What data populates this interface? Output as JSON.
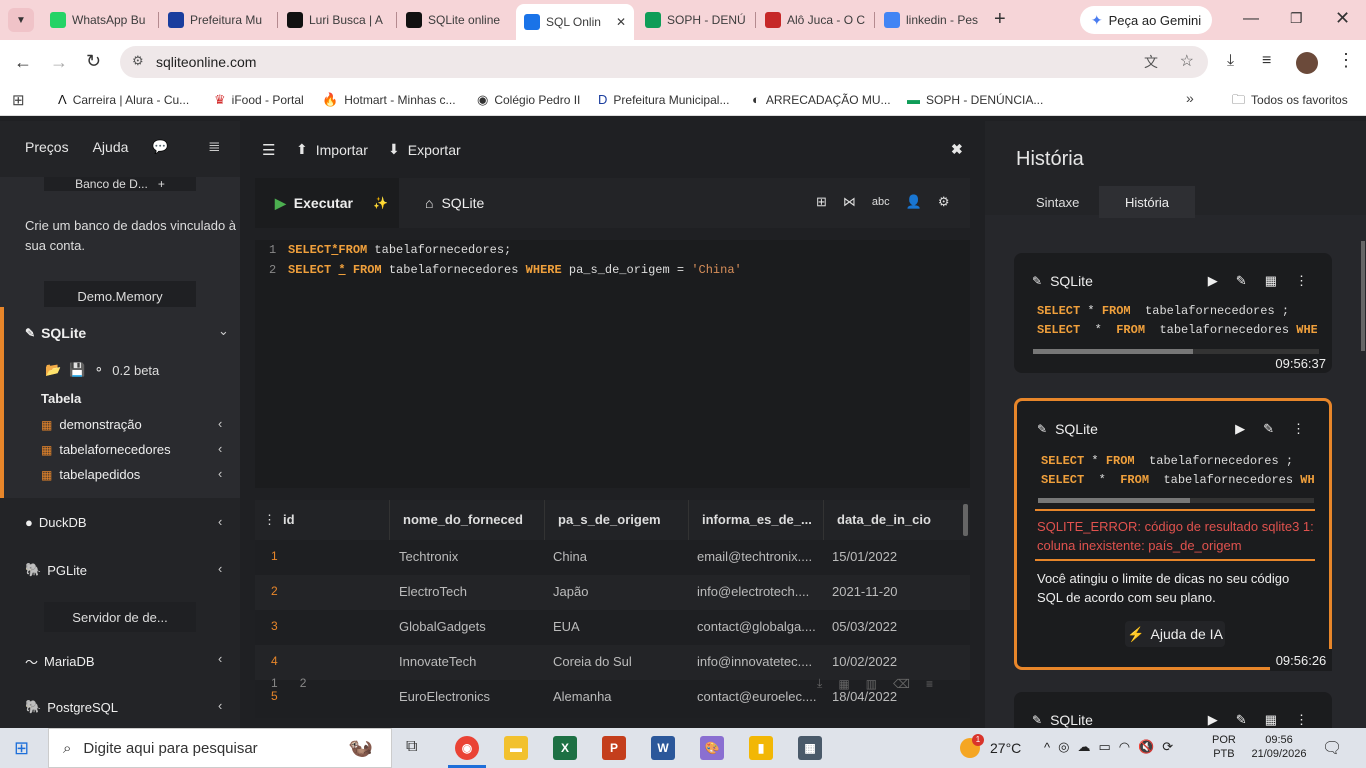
{
  "browser": {
    "tabs": [
      {
        "title": "WhatsApp Bu",
        "icon": "whatsapp-icon",
        "color": "#25d366"
      },
      {
        "title": "Prefeitura Mu",
        "icon": "prefeitura-icon",
        "color": "#1a3d9e"
      },
      {
        "title": "Luri Busca | A",
        "icon": "luri-icon",
        "color": "#111111"
      },
      {
        "title": "SQLite online",
        "icon": "sqlite-icon",
        "color": "#111111"
      },
      {
        "title": "SQL Onlin",
        "icon": "sqlonline-icon",
        "color": "#1a73e8"
      },
      {
        "title": "SOPH - DENÚ",
        "icon": "soph-icon",
        "color": "#0f9d58"
      },
      {
        "title": "Alô Juca - O C",
        "icon": "alojuca-icon",
        "color": "#c62828"
      },
      {
        "title": "linkedin - Pes",
        "icon": "google-icon",
        "color": "#4285f4"
      }
    ],
    "gemini_label": "Peça ao Gemini",
    "url": "sqliteonline.com",
    "bookmarks": [
      "Carreira | Alura - Cu...",
      "iFood - Portal",
      "Hotmart - Minhas c...",
      "Colégio Pedro II",
      "Prefeitura Municipal...",
      "ARRECADAÇÃO MU...",
      "SOPH - DENÚNCIA..."
    ],
    "all_favorites": "Todos os favoritos"
  },
  "sidebar": {
    "prices": "Preços",
    "help": "Ajuda",
    "db_header": "Banco de D...",
    "create_db_text": "Crie um banco de dados vinculado à sua conta.",
    "demo_memory": "Demo.Memory",
    "sqlite_label": "SQLite",
    "version": "0.2 beta",
    "table_header": "Tabela",
    "tables": [
      "demonstração",
      "tabelafornecedores",
      "tabelapedidos"
    ],
    "duckdb": "DuckDB",
    "pglite": "PGLite",
    "server_header": "Servidor de de...",
    "mariadb": "MariaDB",
    "postgresql": "PostgreSQL"
  },
  "editor": {
    "import": "Importar",
    "export": "Exportar",
    "run": "Executar",
    "tab_sqlite": "SQLite",
    "spell_label": "abc",
    "line_numbers": [
      "1",
      "2"
    ],
    "lines": [
      [
        [
          "kw",
          "SELECT"
        ],
        [
          "op",
          "*"
        ],
        [
          "kw",
          "FROM"
        ],
        [
          "tx",
          " tabelafornecedores;"
        ]
      ],
      [
        [
          "kw",
          "SELECT"
        ],
        [
          "tx",
          " "
        ],
        [
          "op",
          "*"
        ],
        [
          "tx",
          " "
        ],
        [
          "kw",
          "FROM"
        ],
        [
          "tx",
          " tabelafornecedores "
        ],
        [
          "kw",
          "WHERE"
        ],
        [
          "tx",
          " pa_s_de_origem = "
        ],
        [
          "str",
          "'China'"
        ]
      ]
    ]
  },
  "results": {
    "columns": [
      "id",
      "nome_do_forneced",
      "pa_s_de_origem",
      "informa_es_de_...",
      "data_de_in_cio"
    ],
    "rows": [
      [
        "1",
        "Techtronix",
        "China",
        "email@techtronix....",
        "15/01/2022"
      ],
      [
        "2",
        "ElectroTech",
        "Japão",
        "info@electrotech....",
        "2021-11-20"
      ],
      [
        "3",
        "GlobalGadgets",
        "EUA",
        "contact@globalga....",
        "05/03/2022"
      ],
      [
        "4",
        "InnovateTech",
        "Coreia do Sul",
        "info@innovatetec....",
        "10/02/2022"
      ],
      [
        "5",
        "EuroElectronics",
        "Alemanha",
        "contact@euroelec....",
        "18/04/2022"
      ]
    ],
    "pages": [
      "1",
      "2"
    ]
  },
  "history": {
    "title": "História",
    "tab_syntax": "Sintaxe",
    "tab_history": "História",
    "cards": [
      {
        "label": "SQLite",
        "q1": [
          [
            "kw",
            "SELECT"
          ],
          [
            "tx",
            " * "
          ],
          [
            "kw",
            "FROM"
          ],
          [
            "tx",
            "  tabelafornecedores ;"
          ]
        ],
        "q2": [
          [
            "kw",
            "SELECT"
          ],
          [
            "tx",
            "  *  "
          ],
          [
            "kw",
            "FROM"
          ],
          [
            "tx",
            "  tabelafornecedores "
          ],
          [
            "kw",
            "WHEI"
          ]
        ],
        "time": "09:56:37",
        "scroll_fraction": 0.56
      },
      {
        "label": "SQLite",
        "q1": [
          [
            "kw",
            "SELECT"
          ],
          [
            "tx",
            " * "
          ],
          [
            "kw",
            "FROM"
          ],
          [
            "tx",
            "  tabelafornecedores ;"
          ]
        ],
        "q2": [
          [
            "kw",
            "SELECT"
          ],
          [
            "tx",
            "  *  "
          ],
          [
            "kw",
            "FROM"
          ],
          [
            "tx",
            "  tabelafornecedores "
          ],
          [
            "kw",
            "WH"
          ]
        ],
        "time": "09:56:26",
        "scroll_fraction": 0.55,
        "error": "SQLITE_ERROR: código de resultado sqlite3 1: coluna inexistente: país_de_origem",
        "limit_msg": "Você atingiu o limite de dicas no seu código SQL de acordo com seu plano.",
        "ai_help": "Ajuda de IA"
      },
      {
        "label": "SQLite"
      }
    ]
  },
  "taskbar": {
    "search_placeholder": "Digite aqui para pesquisar",
    "weather": "27°C",
    "lang1": "POR",
    "lang2": "PTB",
    "time": "09:56",
    "date": "21/09/2026",
    "weather_badge": "1"
  },
  "colors": {
    "accent": "#e8862a",
    "error": "#e0524e",
    "keyword": "#f0a03c",
    "run": "#4caf50"
  }
}
